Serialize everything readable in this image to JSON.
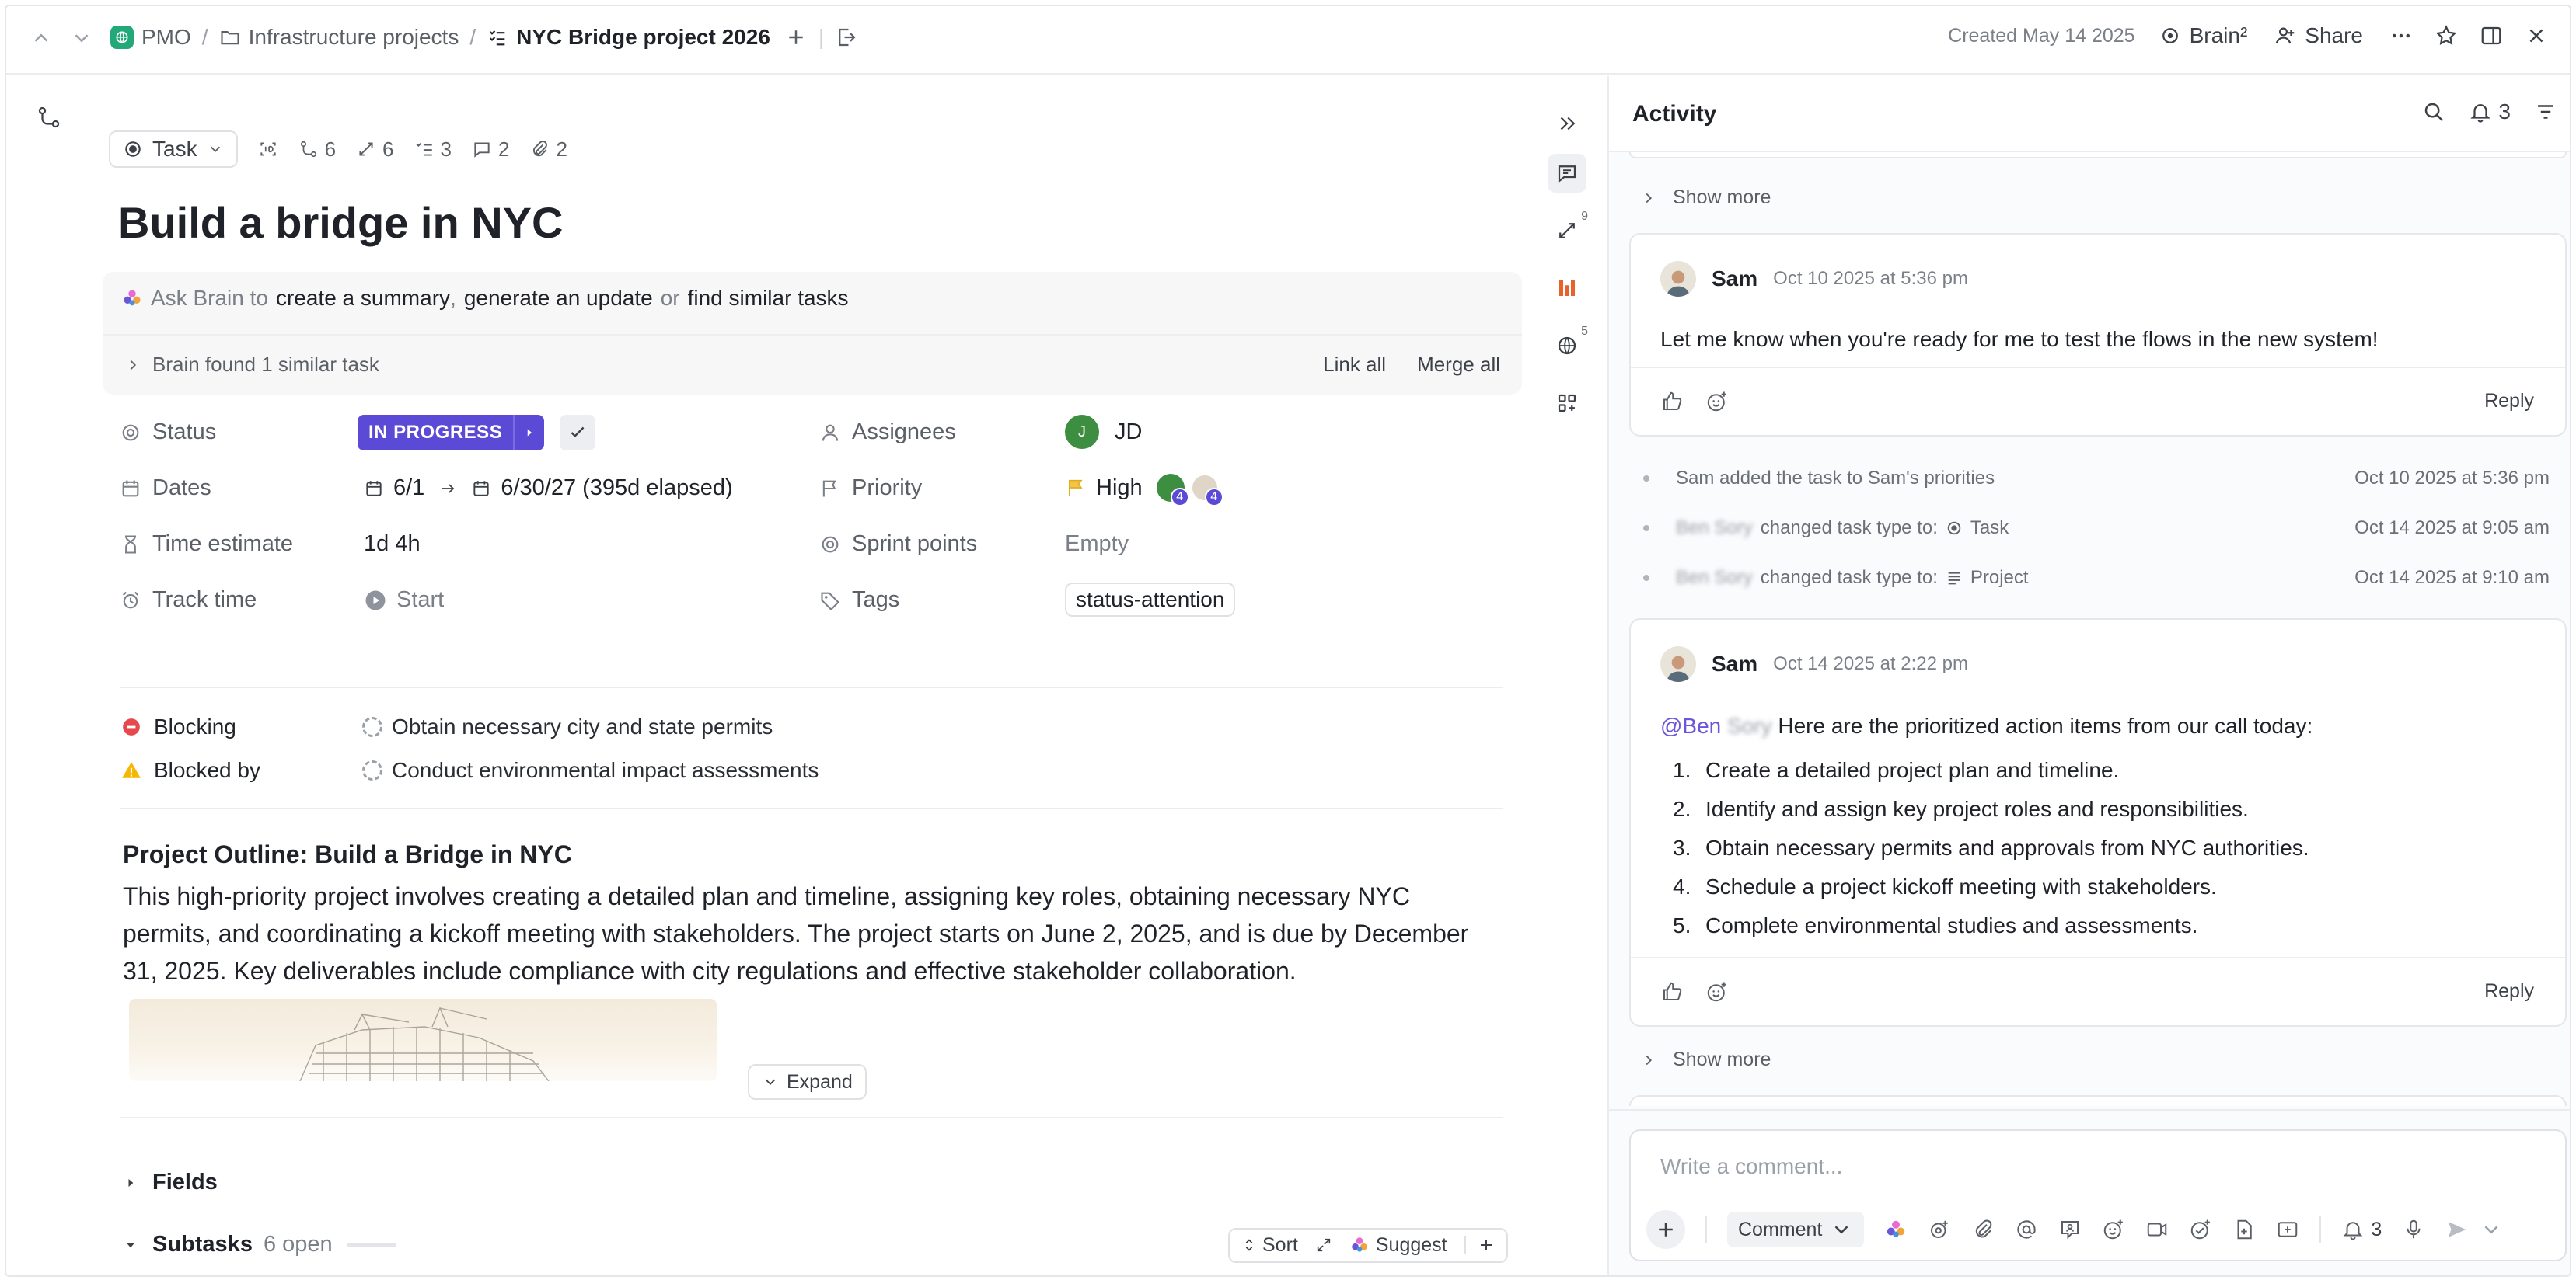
{
  "breadcrumb": {
    "space": "PMO",
    "folder": "Infrastructure projects",
    "list": "NYC Bridge project 2026"
  },
  "header": {
    "created": "Created May 14 2025",
    "brain_label": "Brain²",
    "share_label": "Share"
  },
  "task": {
    "type_label": "Task",
    "meta": {
      "relations": "6",
      "dependencies": "6",
      "checklists": "3",
      "comments": "2",
      "attachments": "2"
    },
    "title": "Build a bridge in NYC"
  },
  "brain": {
    "prefix": "Ask Brain to",
    "action1": "create a summary",
    "comma": ",",
    "action2": "generate an update",
    "or": "or",
    "action3": "find similar tasks",
    "found": "Brain found 1 similar task",
    "link_all": "Link all",
    "merge_all": "Merge all"
  },
  "fields": {
    "status_label": "Status",
    "status_value": "IN PROGRESS",
    "dates_label": "Dates",
    "date_start": "6/1",
    "date_end": "6/30/27 (395d elapsed)",
    "time_estimate_label": "Time estimate",
    "time_estimate_value": "1d 4h",
    "track_time_label": "Track time",
    "track_time_value": "Start",
    "assignees_label": "Assignees",
    "assignee_initial": "J",
    "assignee_name": "JD",
    "priority_label": "Priority",
    "priority_value": "High",
    "sprint_label": "Sprint points",
    "sprint_value": "Empty",
    "tags_label": "Tags",
    "tag_value": "status-attention",
    "watcher_count_1": "4",
    "watcher_count_2": "4"
  },
  "dependencies": {
    "blocking_label": "Blocking",
    "blocking_task": "Obtain necessary city and state permits",
    "blocked_by_label": "Blocked by",
    "blocked_by_task": "Conduct environmental impact assessments"
  },
  "description": {
    "heading": "Project Outline: Build a Bridge in NYC",
    "body": "This high-priority project involves creating a detailed plan and timeline, assigning key roles, obtaining necessary NYC permits, and coordinating a kickoff meeting with stakeholders. The project starts on June 2, 2025, and is due by December 31, 2025. Key deliverables include compliance with city regulations and effective stakeholder collaboration.",
    "expand_label": "Expand"
  },
  "sections": {
    "fields_label": "Fields",
    "subtasks_label": "Subtasks",
    "subtasks_open": "6 open",
    "sort_label": "Sort",
    "suggest_label": "Suggest"
  },
  "rail": {
    "badge1": "9",
    "badge2": "5"
  },
  "activity": {
    "title": "Activity",
    "notif_count": "3",
    "show_more": "Show more",
    "comment1": {
      "author": "Sam",
      "time": "Oct 10 2025 at 5:36 pm",
      "text": "Let me know when you're ready for me to test the flows in the new system!",
      "reply": "Reply"
    },
    "events": [
      {
        "text": "Sam added the task to Sam's priorities",
        "time": "Oct 10 2025 at 5:36 pm"
      },
      {
        "actor": "Ben Sory",
        "text": "changed task type to:",
        "value": "Task",
        "time": "Oct 14 2025 at 9:05 am"
      },
      {
        "actor": "Ben Sory",
        "text": "changed task type to:",
        "value": "Project",
        "time": "Oct 14 2025 at 9:10 am"
      }
    ],
    "comment2": {
      "author": "Sam",
      "time": "Oct 14 2025 at 2:22 pm",
      "mention": "@Ben",
      "mention_blur": "Sory",
      "intro": "Here are the prioritized action items from our call today:",
      "items": [
        "Create a detailed project plan and timeline.",
        "Identify and assign key project roles and responsibilities.",
        "Obtain necessary permits and approvals from NYC authorities.",
        "Schedule a project kickoff meeting with stakeholders.",
        "Complete environmental studies and assessments."
      ],
      "reply": "Reply"
    },
    "composer": {
      "placeholder": "Write a comment...",
      "mode": "Comment",
      "notif_count": "3"
    }
  },
  "colors": {
    "accent": "#5b4ad6",
    "priority_flag": "#f4c542",
    "blocking": "#e5484d",
    "warning": "#f5b700"
  }
}
